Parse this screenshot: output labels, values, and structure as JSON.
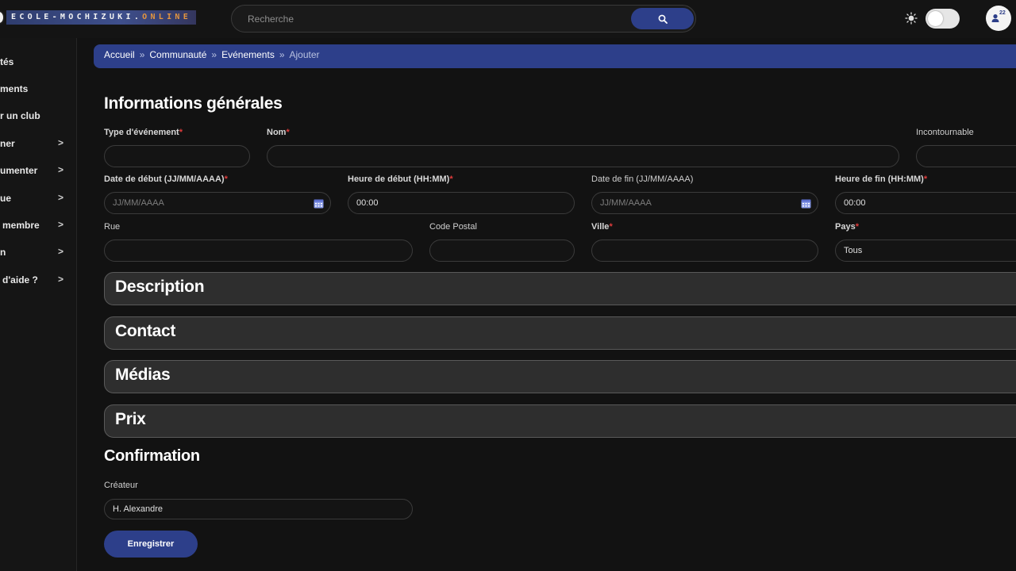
{
  "header": {
    "logo_main": "ECOLE-MOCHIZUKI",
    "logo_dot": ".",
    "logo_suffix": "ONLINE",
    "search": {
      "placeholder": "Recherche"
    },
    "notifications_count": "22",
    "theme_icon": "sun-icon",
    "search_icon": "magnifier-icon"
  },
  "sidebar": {
    "items": [
      {
        "label": "tés",
        "has_chevron": false
      },
      {
        "label": "ments",
        "has_chevron": false
      },
      {
        "label": "r un club",
        "has_chevron": false
      },
      {
        "label": "ner",
        "has_chevron": true
      },
      {
        "label": "umenter",
        "has_chevron": true
      },
      {
        "label": "ue",
        "has_chevron": true
      },
      {
        "label": "membre",
        "has_chevron": true
      },
      {
        "label": "n",
        "has_chevron": true
      },
      {
        "label": "d'aide ?",
        "has_chevron": true
      }
    ],
    "chevron": ">"
  },
  "breadcrumb": {
    "items": [
      "Accueil",
      "Communauté",
      "Evénements"
    ],
    "separator": "»",
    "current": "Ajouter"
  },
  "form": {
    "title": "Informations générales",
    "required_mark": "*",
    "labels": {
      "type": "Type d'événement",
      "name": "Nom",
      "incontournable": "Incontournable",
      "start_date": "Date de début (JJ/MM/AAAA)",
      "start_time": "Heure de début (HH:MM)",
      "end_date": "Date de fin (JJ/MM/AAAA)",
      "end_time": "Heure de fin (HH:MM)",
      "street": "Rue",
      "postal": "Code Postal",
      "city": "Ville",
      "country": "Pays"
    },
    "values": {
      "start_date_placeholder": "JJ/MM/AAAA",
      "start_time": "00:00",
      "end_date_placeholder": "JJ/MM/AAAA",
      "end_time": "00:00",
      "country": "Tous"
    }
  },
  "sections": [
    "Description",
    "Contact",
    "Médias",
    "Prix"
  ],
  "confirmation": {
    "title": "Confirmation",
    "creator_label": "Créateur",
    "creator_value": "H. Alexandre",
    "save_label": "Enregistrer"
  },
  "colors": {
    "accent": "#2d3f8a",
    "background": "#121212",
    "required": "#e03c3c"
  }
}
